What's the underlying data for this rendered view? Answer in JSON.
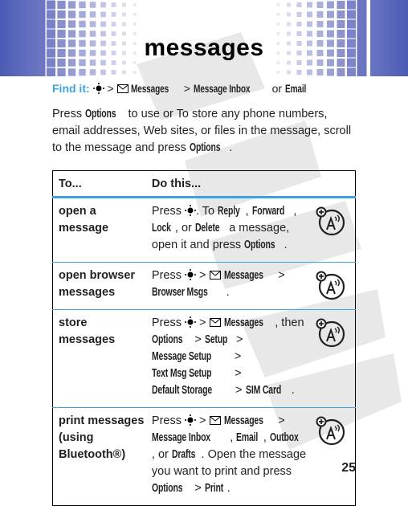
{
  "header": {
    "title": "messages",
    "band_color": "#4b5bb4"
  },
  "find_it": {
    "label": "Find it:",
    "nav_icon": "nav-key-icon",
    "sep1": ">",
    "envelope_icon": "envelope-icon",
    "item1": "Messages",
    "sep2": ">",
    "item2": "Message Inbox",
    "or": "or",
    "item3": "Email"
  },
  "intro": {
    "p1": "Press ",
    "options1": "Options",
    "p2": " to use or To store any phone numbers, email addresses, Web sites, or files in the message, scroll to the message and press ",
    "options2": "Options",
    "p3": "."
  },
  "table": {
    "headers": {
      "to": "To...",
      "do": "Do this..."
    },
    "rows": [
      {
        "to": "open a message",
        "do": [
          {
            "t": "Press "
          },
          {
            "icon": "nav"
          },
          {
            "t": ". To "
          },
          {
            "b": "Reply"
          },
          {
            "t": ", "
          },
          {
            "b": "Forward"
          },
          {
            "t": ", "
          },
          {
            "b": "Lock"
          },
          {
            "t": ", or "
          },
          {
            "b": "Delete"
          },
          {
            "t": " a message, open it and press "
          },
          {
            "b": "Options"
          },
          {
            "t": "."
          }
        ],
        "icon": "network-feature-icon"
      },
      {
        "to": "open browser messages",
        "do": [
          {
            "t": "Press "
          },
          {
            "icon": "nav"
          },
          {
            "t": " > "
          },
          {
            "icon": "env"
          },
          {
            "t": " "
          },
          {
            "b": "Messages"
          },
          {
            "t": " > "
          },
          {
            "b": "Browser Msgs"
          },
          {
            "t": "."
          }
        ],
        "icon": "network-feature-icon"
      },
      {
        "to": "store messages",
        "do": [
          {
            "t": "Press "
          },
          {
            "icon": "nav"
          },
          {
            "t": " > "
          },
          {
            "icon": "env"
          },
          {
            "t": " "
          },
          {
            "b": "Messages"
          },
          {
            "t": ", then "
          },
          {
            "b": "Options"
          },
          {
            "t": " > "
          },
          {
            "b": "Setup"
          },
          {
            "t": " > "
          },
          {
            "b": "Message Setup"
          },
          {
            "t": " > "
          },
          {
            "b": "Text Msg Setup"
          },
          {
            "t": " > "
          },
          {
            "b": "Default Storage"
          },
          {
            "t": " > "
          },
          {
            "b": "SIM Card"
          },
          {
            "t": "."
          }
        ],
        "icon": "network-feature-icon"
      },
      {
        "to": "print messages (using Bluetooth®)",
        "do": [
          {
            "t": "Press "
          },
          {
            "icon": "nav"
          },
          {
            "t": " > "
          },
          {
            "icon": "env"
          },
          {
            "t": " "
          },
          {
            "b": "Messages"
          },
          {
            "t": " > "
          },
          {
            "b": "Message Inbox"
          },
          {
            "t": ", "
          },
          {
            "b": "Email"
          },
          {
            "t": ", "
          },
          {
            "b": "Outbox"
          },
          {
            "t": ", or "
          },
          {
            "b": "Drafts"
          },
          {
            "t": ". Open the message you want to print and press "
          },
          {
            "b": "Options"
          },
          {
            "t": " > "
          },
          {
            "b": "Print"
          },
          {
            "t": "."
          }
        ],
        "icon": "network-feature-icon"
      }
    ]
  },
  "watermark": "DRAFT",
  "page_number": "25",
  "colors": {
    "accent": "#3ba4e0",
    "text": "#231f20"
  }
}
